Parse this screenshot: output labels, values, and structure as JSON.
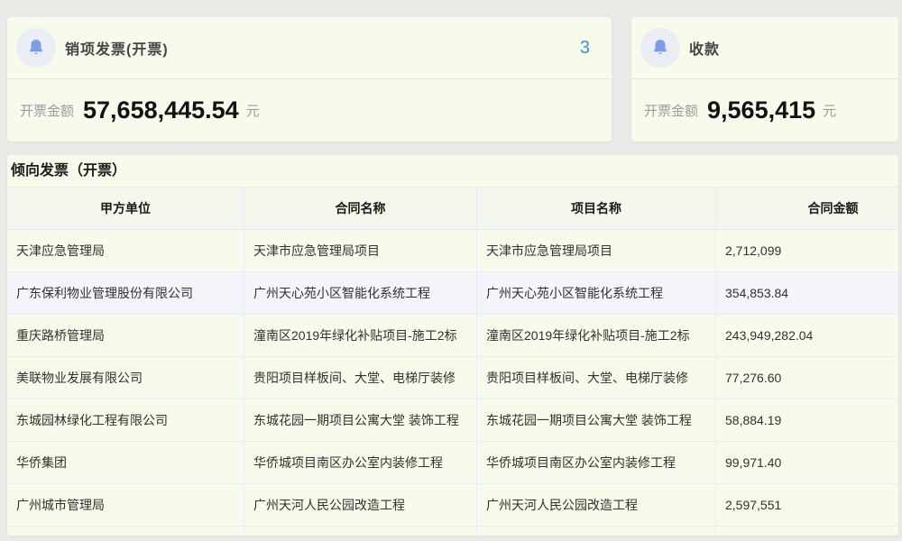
{
  "cards": [
    {
      "title": "销项发票(开票)",
      "badge": "3",
      "amount_label": "开票金额",
      "amount": "57,658,445.54",
      "unit": "元",
      "icon": "bell-icon"
    },
    {
      "title": "收款",
      "amount_label": "开票金额",
      "amount": "9,565,415",
      "unit": "元",
      "icon": "bell-icon"
    }
  ],
  "table": {
    "title": "倾向发票（开票）",
    "columns": [
      "甲方单位",
      "合同名称",
      "项目名称",
      "合同金额"
    ],
    "rows": [
      [
        "天津应急管理局",
        "天津市应急管理局项目",
        "天津市应急管理局项目",
        "2,712,099"
      ],
      [
        "广东保利物业管理股份有限公司",
        "广州天心苑小区智能化系统工程",
        "广州天心苑小区智能化系统工程",
        "354,853.84"
      ],
      [
        "重庆路桥管理局",
        "潼南区2019年绿化补贴项目-施工2标",
        "潼南区2019年绿化补贴项目-施工2标",
        "243,949,282.04"
      ],
      [
        "美联物业发展有限公司",
        "贵阳项目样板间、大堂、电梯厅装修",
        "贵阳项目样板间、大堂、电梯厅装修",
        "77,276.60"
      ],
      [
        "东城园林绿化工程有限公司",
        "东城花园一期项目公寓大堂 装饰工程",
        "东城花园一期项目公寓大堂 装饰工程",
        "58,884.19"
      ],
      [
        "华侨集团",
        "华侨城项目南区办公室内装修工程",
        "华侨城项目南区办公室内装修工程",
        "99,971.40"
      ],
      [
        "广州城市管理局",
        "广州天河人民公园改造工程",
        "广州天河人民公园改造工程",
        "2,597,551"
      ]
    ],
    "highlighted_row_index": 1
  },
  "colors": {
    "panel_bg": "#f7fbec",
    "page_bg": "#e9ebe7",
    "badge_blue": "#3c8fd9",
    "bell_icon": "#7e9cec",
    "bell_circle_bg": "#eaedf4",
    "row_highlight": "#f3f5fa",
    "divider": "#e8edf3"
  }
}
